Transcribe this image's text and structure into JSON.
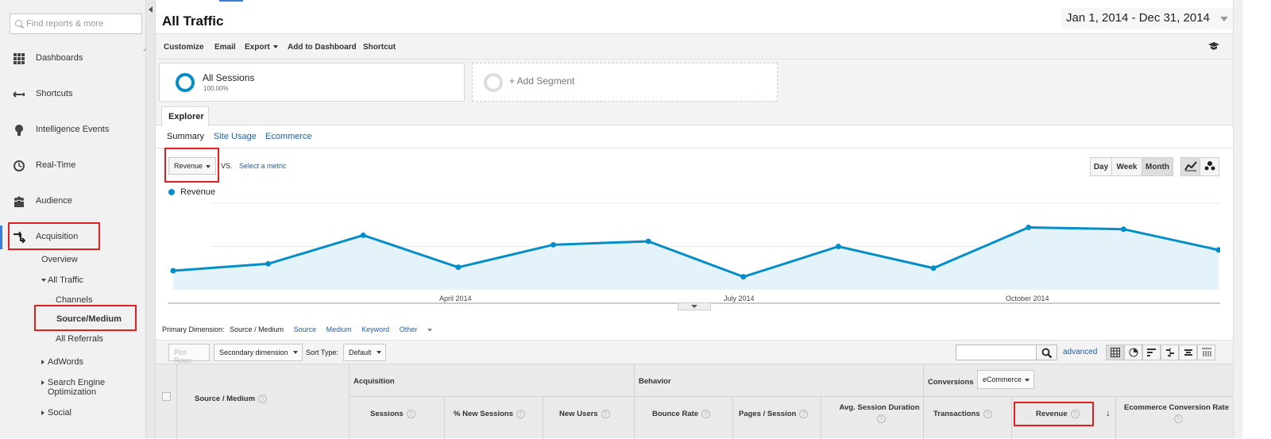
{
  "sidebar": {
    "search_placeholder": "Find reports & more",
    "items": [
      {
        "label": "Dashboards"
      },
      {
        "label": "Shortcuts"
      },
      {
        "label": "Intelligence Events"
      },
      {
        "label": "Real-Time"
      },
      {
        "label": "Audience"
      },
      {
        "label": "Acquisition"
      }
    ],
    "sub": {
      "overview": "Overview",
      "all_traffic": "All Traffic",
      "channels": "Channels",
      "source_medium": "Source/Medium",
      "all_referrals": "All Referrals",
      "adwords": "AdWords",
      "seo_line1": "Search Engine",
      "seo_line2": "Optimization",
      "social": "Social"
    }
  },
  "header": {
    "title": "All Traffic",
    "date_range": "Jan 1, 2014 - Dec 31, 2014"
  },
  "toolbar": {
    "customize": "Customize",
    "email": "Email",
    "export": "Export",
    "add_to_dashboard": "Add to Dashboard",
    "shortcut": "Shortcut"
  },
  "segments": {
    "all_sessions": "All Sessions",
    "all_sessions_pct": "100.00%",
    "add_segment": "+ Add Segment"
  },
  "explorer": {
    "tab": "Explorer",
    "subtabs": [
      "Summary",
      "Site Usage",
      "Ecommerce"
    ],
    "metric": "Revenue",
    "vs": "VS.",
    "select_metric": "Select a metric",
    "granularity": [
      "Day",
      "Week",
      "Month"
    ],
    "active_granularity": "Month"
  },
  "chart_data": {
    "type": "area",
    "series": [
      {
        "name": "Revenue",
        "values": [
          22,
          30,
          63,
          26,
          52,
          56,
          15,
          50,
          25,
          72,
          70,
          46
        ]
      }
    ],
    "x": [
      "Jan 2014",
      "Feb 2014",
      "Mar 2014",
      "Apr 2014",
      "May 2014",
      "Jun 2014",
      "Jul 2014",
      "Aug 2014",
      "Sep 2014",
      "Oct 2014",
      "Nov 2014",
      "Dec 2014"
    ],
    "tick_labels": [
      "April 2014",
      "July 2014",
      "October 2014"
    ],
    "ylim": [
      0,
      100
    ],
    "legend": "top-left",
    "color": "#058dc7",
    "fill": "#e4f2f9",
    "grid": true
  },
  "primary_dimension": {
    "label": "Primary Dimension:",
    "active": "Source / Medium",
    "options": [
      "Source",
      "Medium",
      "Keyword",
      "Other"
    ]
  },
  "filters": {
    "plot_rows": "Plot Rows",
    "secondary_dimension": "Secondary dimension",
    "sort_type_label": "Sort Type:",
    "sort_type": "Default",
    "advanced": "advanced"
  },
  "table": {
    "source_medium": "Source / Medium",
    "groups": {
      "acquisition": "Acquisition",
      "behavior": "Behavior",
      "conversions": "Conversions",
      "conversions_select": "eCommerce"
    },
    "columns": {
      "sessions": "Sessions",
      "new_sessions": "% New Sessions",
      "new_users": "New Users",
      "bounce_rate": "Bounce Rate",
      "pages_session": "Pages / Session",
      "avg_duration": "Avg. Session Duration",
      "transactions": "Transactions",
      "revenue": "Revenue",
      "ecr": "Ecommerce Conversion Rate"
    }
  }
}
